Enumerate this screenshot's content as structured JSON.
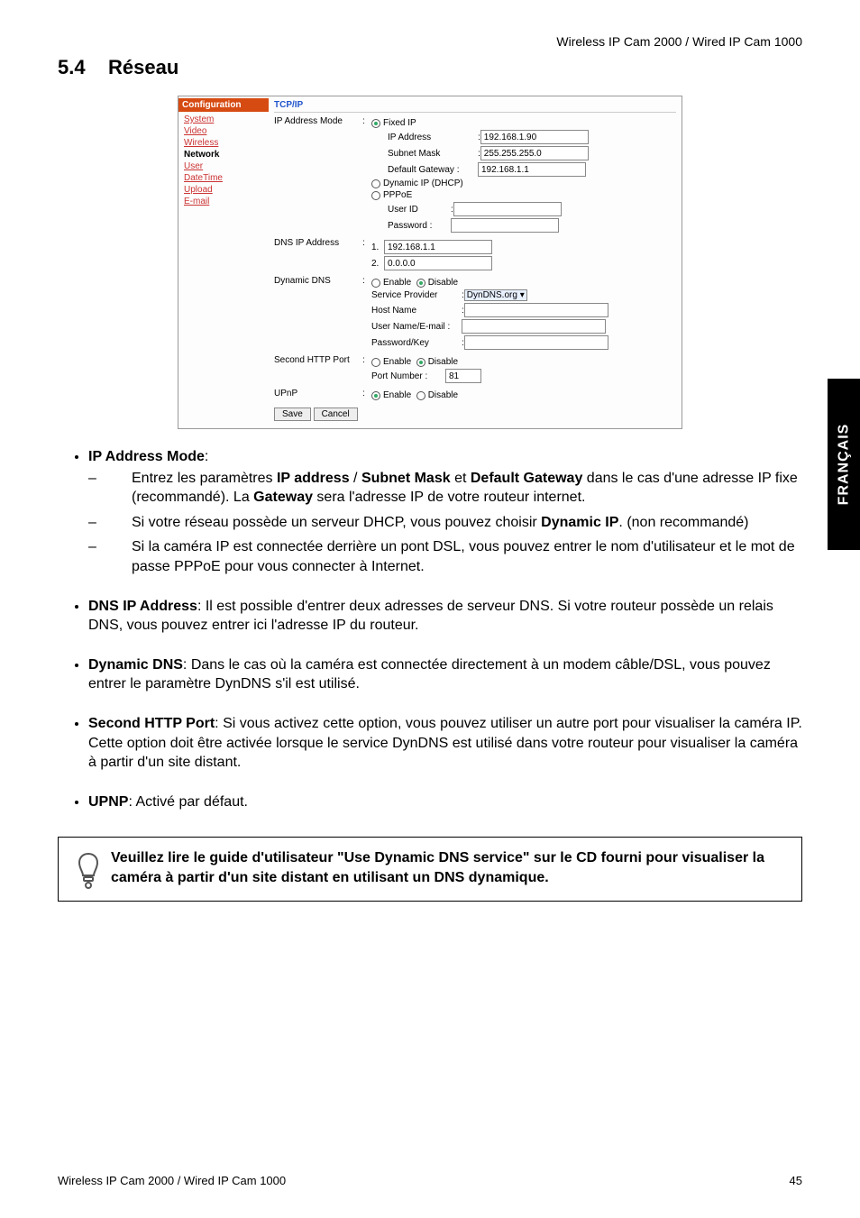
{
  "header": {
    "product": "Wireless IP Cam 2000 / Wired IP Cam 1000"
  },
  "section": {
    "number": "5.4",
    "title": "Réseau"
  },
  "sideTab": "FRANÇAIS",
  "shot": {
    "leftHeader": "Configuration",
    "nav": {
      "system": "System",
      "video": "Video",
      "wireless": "Wireless",
      "network": "Network",
      "user": "User",
      "datetime": "DateTime",
      "upload": "Upload",
      "email": "E-mail"
    },
    "rightHeader": "TCP/IP",
    "ipMode": {
      "label": "IP Address Mode",
      "fixed": "Fixed IP",
      "ipAddr": {
        "label": "IP Address",
        "value": "192.168.1.90"
      },
      "subnet": {
        "label": "Subnet Mask",
        "value": "255.255.255.0"
      },
      "gateway": {
        "label": "Default Gateway :",
        "value": "192.168.1.1"
      },
      "dhcp": "Dynamic IP (DHCP)",
      "pppoe": "PPPoE",
      "userId": "User ID",
      "password": "Password :"
    },
    "dns": {
      "label": "DNS IP Address",
      "n1": "1.",
      "v1": "192.168.1.1",
      "n2": "2.",
      "v2": "0.0.0.0"
    },
    "ddns": {
      "label": "Dynamic DNS",
      "enable": "Enable",
      "disable": "Disable",
      "provider": "Service Provider",
      "providerVal": "DynDNS.org",
      "host": "Host Name",
      "user": "User Name/E-mail :",
      "pass": "Password/Key"
    },
    "second": {
      "label": "Second HTTP Port",
      "enable": "Enable",
      "disable": "Disable",
      "portLabel": "Port Number :",
      "portVal": "81"
    },
    "upnp": {
      "label": "UPnP",
      "enable": "Enable",
      "disable": "Disable"
    },
    "save": "Save",
    "cancel": "Cancel"
  },
  "body": {
    "ipModeTitle": "IP Address Mode",
    "ipMode1a": "Entrez les paramètres ",
    "ipMode1b": "IP address",
    "ipMode1c": " / ",
    "ipMode1d": "Subnet Mask",
    "ipMode1e": " et ",
    "ipMode1f": "Default Gateway",
    "ipMode1g": " dans le cas d'une adresse IP fixe (recommandé). La ",
    "ipMode1h": "Gateway",
    "ipMode1i": " sera l'adresse IP de votre routeur internet.",
    "ipMode2a": "Si votre réseau possède un serveur DHCP, vous pouvez choisir ",
    "ipMode2b": "Dynamic IP",
    "ipMode2c": ". (non recommandé)",
    "ipMode3": "Si la caméra IP est connectée derrière un pont DSL, vous pouvez entrer le nom d'utilisateur et le mot de passe PPPoE pour vous connecter à Internet.",
    "dnsTitle": "DNS IP Address",
    "dnsText": ": Il est possible d'entrer deux adresses de serveur DNS. Si votre routeur possède un relais DNS, vous pouvez entrer ici l'adresse IP du routeur.",
    "ddnsTitle": "Dynamic DNS",
    "ddnsText": ": Dans le cas où la caméra est connectée directement à un modem câble/DSL, vous pouvez entrer le paramètre DynDNS s'il est utilisé.",
    "secondTitle": "Second HTTP Port",
    "secondText": ": Si vous activez cette option, vous pouvez utiliser un autre port pour visualiser la caméra IP. Cette option doit être activée lorsque le service DynDNS est utilisé dans votre routeur pour visualiser la caméra à partir d'un site distant.",
    "upnpTitle": "UPNP",
    "upnpText": ": Activé par défaut."
  },
  "note": "Veuillez lire le guide d'utilisateur \"Use Dynamic DNS service\" sur le CD fourni pour visualiser la caméra à partir d'un site distant en utilisant un DNS dynamique.",
  "footer": {
    "left": "Wireless IP Cam 2000 / Wired IP Cam 1000",
    "right": "45"
  }
}
